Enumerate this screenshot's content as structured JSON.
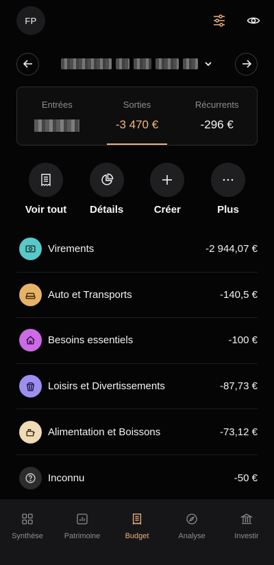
{
  "header": {
    "avatar_initials": "FP",
    "icons": [
      "filter-sliders-icon",
      "eye-icon"
    ]
  },
  "period": {
    "prev_icon": "arrow-left-icon",
    "next_icon": "arrow-right-icon",
    "dropdown_icon": "chevron-down-icon"
  },
  "summary": {
    "tabs": [
      {
        "label": "Entrées",
        "value": null
      },
      {
        "label": "Sorties",
        "value": "-3 470 €",
        "active": true
      },
      {
        "label": "Récurrents",
        "value": "-296 €"
      }
    ]
  },
  "actions": [
    {
      "label": "Voir tout",
      "icon": "receipt-icon"
    },
    {
      "label": "Détails",
      "icon": "pie-chart-icon"
    },
    {
      "label": "Créer",
      "icon": "plus-icon"
    },
    {
      "label": "Plus",
      "icon": "more-icon"
    }
  ],
  "categories": [
    {
      "name": "Virements",
      "amount": "-2 944,07 €",
      "icon": "transfer-icon",
      "color": "#5ac8c8"
    },
    {
      "name": "Auto et Transports",
      "amount": "-140,5 €",
      "icon": "car-icon",
      "color": "#e8b266"
    },
    {
      "name": "Besoins essentiels",
      "amount": "-100 €",
      "icon": "home-icon",
      "color": "#cd6ae6"
    },
    {
      "name": "Loisirs et Divertissements",
      "amount": "-87,73 €",
      "icon": "popcorn-icon",
      "color": "#9d8ff0"
    },
    {
      "name": "Alimentation et Boissons",
      "amount": "-73,12 €",
      "icon": "groceries-icon",
      "color": "#f0dcb4"
    },
    {
      "name": "Inconnu",
      "amount": "-50 €",
      "icon": "question-icon",
      "color": "#2c2c2e"
    }
  ],
  "tabbar": {
    "items": [
      {
        "label": "Synthèse",
        "icon": "grid-icon"
      },
      {
        "label": "Patrimoine",
        "icon": "bar-chart-icon"
      },
      {
        "label": "Budget",
        "icon": "receipt-icon",
        "active": true
      },
      {
        "label": "Analyse",
        "icon": "compass-icon"
      },
      {
        "label": "Investir",
        "icon": "bank-icon"
      }
    ]
  },
  "colors": {
    "accent": "#e9b27a",
    "background": "#050505",
    "muted": "#8e8e93"
  }
}
